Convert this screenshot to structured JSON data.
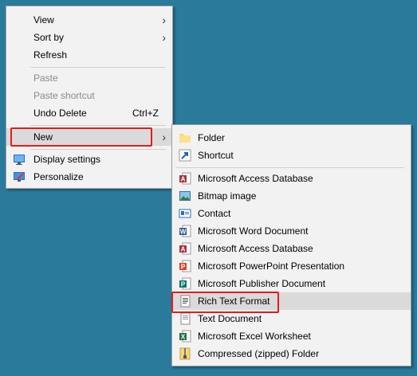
{
  "context_menu": {
    "items": [
      {
        "label": "View",
        "submenu": true
      },
      {
        "label": "Sort by",
        "submenu": true
      },
      {
        "label": "Refresh"
      },
      {
        "label": "Paste",
        "disabled": true
      },
      {
        "label": "Paste shortcut",
        "disabled": true
      },
      {
        "label": "Undo Delete",
        "shortcut": "Ctrl+Z"
      },
      {
        "label": "New",
        "submenu": true,
        "highlighted": true
      },
      {
        "label": "Display settings",
        "icon": "display-settings-icon"
      },
      {
        "label": "Personalize",
        "icon": "personalize-icon"
      }
    ]
  },
  "new_submenu": {
    "items": [
      {
        "label": "Folder",
        "icon": "folder-icon"
      },
      {
        "label": "Shortcut",
        "icon": "shortcut-icon"
      },
      {
        "label": "Microsoft Access Database",
        "icon": "access-icon"
      },
      {
        "label": "Bitmap image",
        "icon": "bitmap-icon"
      },
      {
        "label": "Contact",
        "icon": "contact-icon"
      },
      {
        "label": "Microsoft Word Document",
        "icon": "word-icon"
      },
      {
        "label": "Microsoft Access Database",
        "icon": "access-icon"
      },
      {
        "label": "Microsoft PowerPoint Presentation",
        "icon": "powerpoint-icon"
      },
      {
        "label": "Microsoft Publisher Document",
        "icon": "publisher-icon"
      },
      {
        "label": "Rich Text Format",
        "icon": "rtf-icon",
        "highlighted": true
      },
      {
        "label": "Text Document",
        "icon": "text-document-icon"
      },
      {
        "label": "Microsoft Excel Worksheet",
        "icon": "excel-icon"
      },
      {
        "label": "Compressed (zipped) Folder",
        "icon": "zip-folder-icon"
      }
    ]
  },
  "colors": {
    "desktop": "#2a7a9c",
    "menu_bg": "#f2f2f2",
    "highlight": "#dadada",
    "annotation_red": "#e31b1b"
  }
}
